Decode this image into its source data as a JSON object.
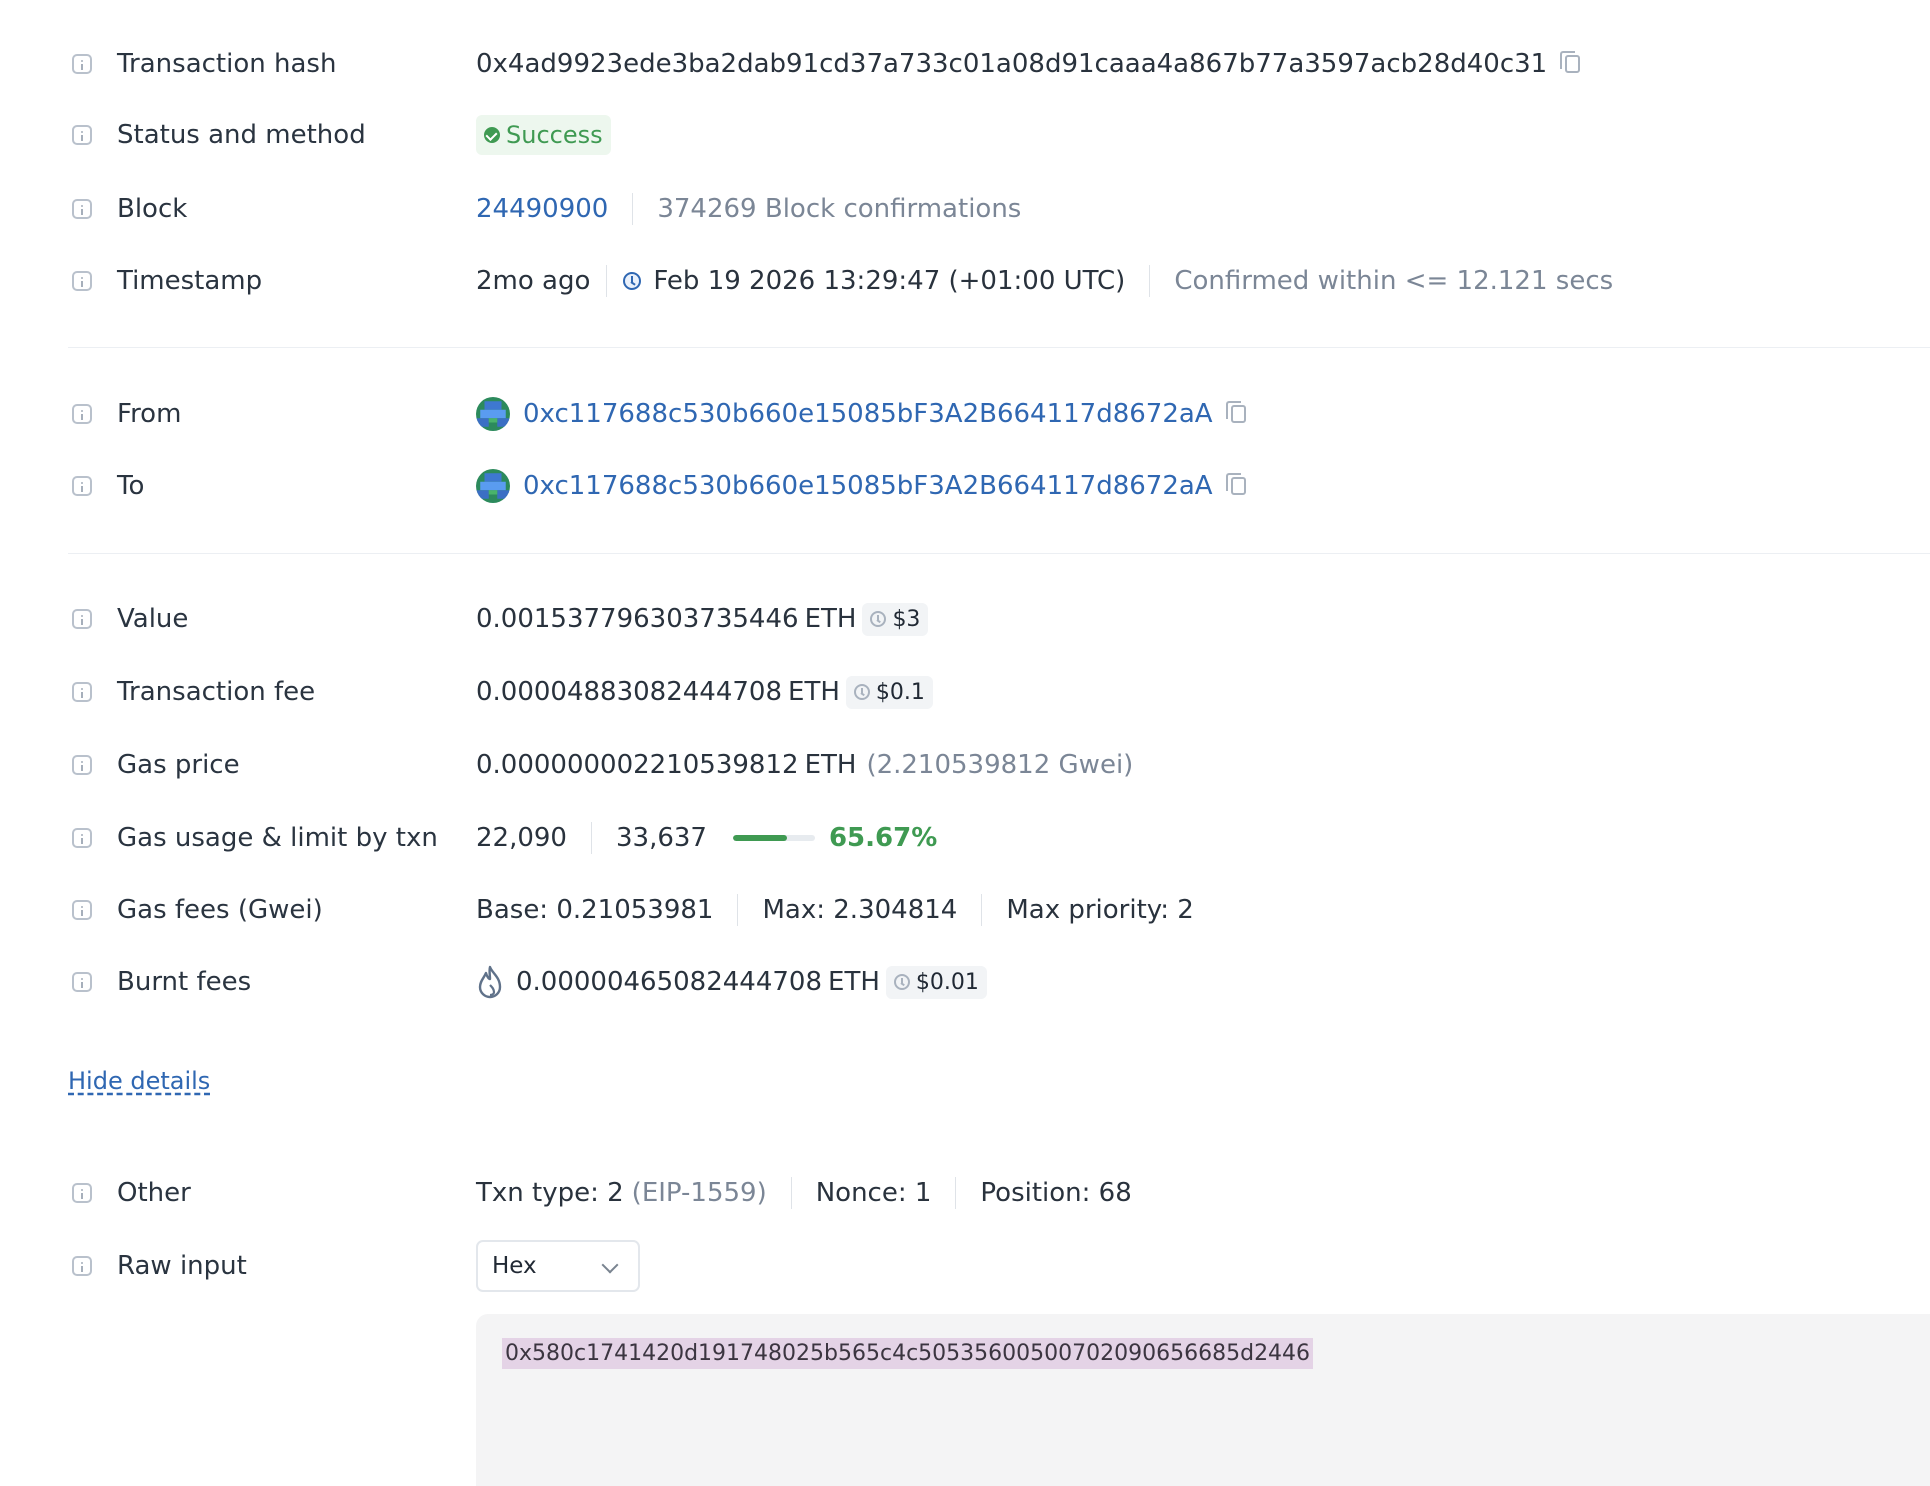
{
  "rows": {
    "tx_hash": {
      "label": "Transaction hash",
      "value": "0x4ad9923ede3ba2dab91cd37a733c01a08d91caaa4a867b77a3597acb28d40c31"
    },
    "status": {
      "label": "Status and method",
      "value": "Success"
    },
    "block": {
      "label": "Block",
      "number": "24490900",
      "confirmations": "374269 Block confirmations"
    },
    "timestamp": {
      "label": "Timestamp",
      "ago": "2mo ago",
      "datetime": "Feb 19 2026 13:29:47 (+01:00 UTC)",
      "confirmed": "Confirmed within <= 12.121 secs"
    },
    "from": {
      "label": "From",
      "address": "0xc117688c530b660e15085bF3A2B664117d8672aA"
    },
    "to": {
      "label": "To",
      "address": "0xc117688c530b660e15085bF3A2B664117d8672aA"
    },
    "value": {
      "label": "Value",
      "amount": "0.001537796303735446",
      "unit": "ETH",
      "usd": "$3"
    },
    "tx_fee": {
      "label": "Transaction fee",
      "amount": "0.00004883082444708",
      "unit": "ETH",
      "usd": "$0.1"
    },
    "gas_price": {
      "label": "Gas price",
      "amount": "0.000000002210539812",
      "unit": "ETH",
      "gwei": "(2.210539812 Gwei)"
    },
    "gas_usage": {
      "label": "Gas usage & limit by txn",
      "used": "22,090",
      "limit": "33,637",
      "percent": "65.67%",
      "ratio": 0.6567
    },
    "gas_fees": {
      "label": "Gas fees (Gwei)",
      "base": "Base: 0.21053981",
      "max": "Max: 2.304814",
      "max_priority": "Max priority: 2"
    },
    "burnt_fees": {
      "label": "Burnt fees",
      "amount": "0.00000465082444708",
      "unit": "ETH",
      "usd": "$0.01"
    },
    "other": {
      "label": "Other",
      "txn_type": "Txn type: 2",
      "txn_type_name": "(EIP-1559)",
      "nonce": "Nonce: 1",
      "position": "Position: 68"
    },
    "raw_input": {
      "label": "Raw input",
      "format": "Hex",
      "data": "0x580c1741420d191748025b565c4c5053560050070209065668​5d2446"
    }
  },
  "hide_details": "Hide details",
  "colors": {
    "accent": "#2f67b2",
    "success": "#3f9a52",
    "muted": "#7b8696"
  }
}
